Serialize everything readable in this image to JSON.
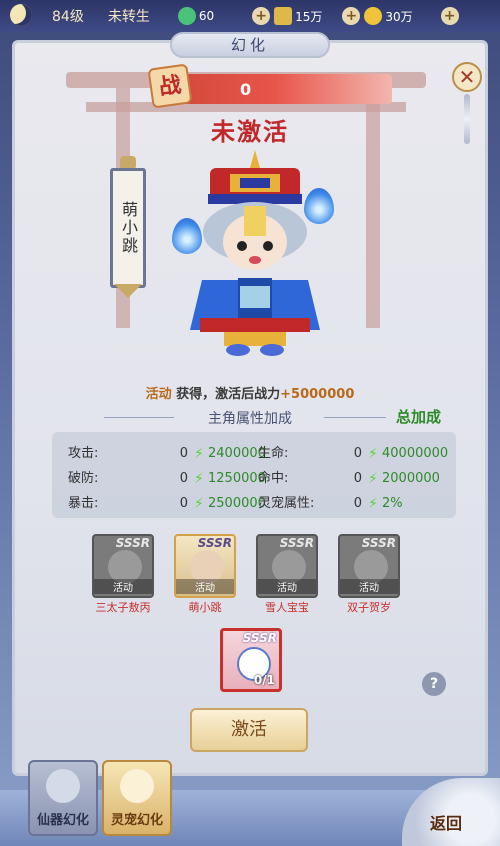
{
  "topbar": {
    "level": "84级",
    "rebirth": "未转生",
    "currency1": "60",
    "currency2": "15万",
    "currency3": "30万"
  },
  "panel": {
    "title": "幻化",
    "power_value": "0",
    "power_icon_char": "战",
    "status": "未激活",
    "pet_name": "萌小跳",
    "info_prefix": "活动",
    "info_mid": " 获得，激活后战力",
    "info_bonus": "+5000000",
    "section_title": "主角属性加成",
    "total_label": "总加成"
  },
  "stats": [
    {
      "label": "攻击:",
      "cur": "0",
      "add": "2400000"
    },
    {
      "label": "破防:",
      "cur": "0",
      "add": "1250000"
    },
    {
      "label": "暴击:",
      "cur": "0",
      "add": "2500000"
    },
    {
      "label": "生命:",
      "cur": "0",
      "add": "40000000"
    },
    {
      "label": "命中:",
      "cur": "0",
      "add": "2000000"
    },
    {
      "label": "灵宠属性:",
      "cur": "0",
      "add": "2%"
    }
  ],
  "cards": [
    {
      "rarity": "SSSR",
      "tag": "活动",
      "name": "三太子敖丙"
    },
    {
      "rarity": "SSSR",
      "tag": "活动",
      "name": "萌小跳"
    },
    {
      "rarity": "SSSR",
      "tag": "活动",
      "name": "雪人宝宝"
    },
    {
      "rarity": "SSSR",
      "tag": "活动",
      "name": "双子贺岁"
    }
  ],
  "material": {
    "rarity": "SSSR",
    "count": "0/1"
  },
  "buttons": {
    "help": "?",
    "activate": "激活",
    "back": "返回",
    "close": "✕"
  },
  "tabs": [
    {
      "label": "仙器幻化"
    },
    {
      "label": "灵宠幻化"
    }
  ],
  "colors": {
    "accent_red": "#c0282a",
    "green_bonus": "#2e8a2a",
    "gold": "#b86a1a"
  }
}
